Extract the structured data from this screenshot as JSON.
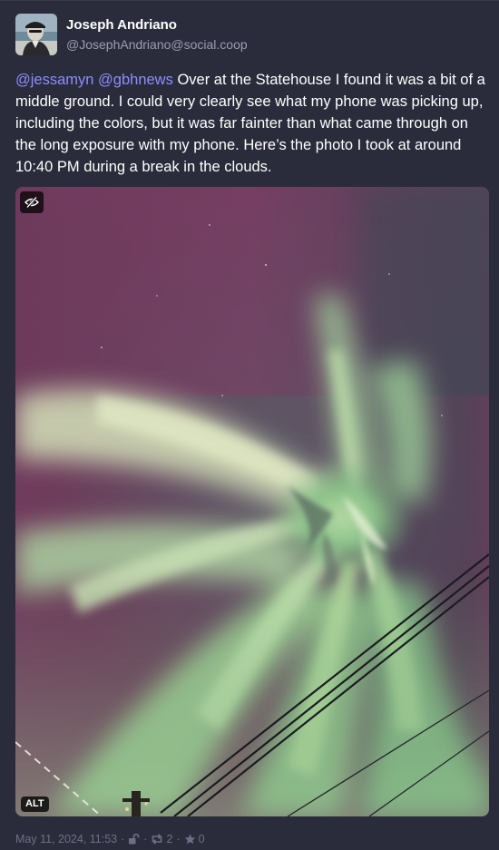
{
  "author": {
    "display_name": "Joseph Andriano",
    "handle": "@JosephAndriano@social.coop"
  },
  "post": {
    "mention_1": "@jessamyn",
    "mention_2": "@gbhnews",
    "body": " Over at the Statehouse I found it was a bit of a middle ground. I could very clearly see what my phone was picking up, including the colors, but it was far fainter than what came through on the long exposure with my phone. Here’s the photo I took at around 10:40 PM during a break in the clouds.",
    "space": " "
  },
  "media": {
    "alt_label": "ALT"
  },
  "meta": {
    "timestamp": "May 11, 2024, 11:53",
    "separator": "·",
    "boost_count": "2",
    "favourite_count": "0"
  },
  "icons": {
    "hide_media": "eye-slash-icon",
    "visibility": "unlock-icon",
    "boost": "retweet-icon",
    "favourite": "star-icon"
  },
  "colors": {
    "background": "#2b2c3b",
    "text": "#ffffff",
    "muted": "#9a9cb4",
    "mention": "#8c8dff",
    "meta": "#6d6f85"
  }
}
